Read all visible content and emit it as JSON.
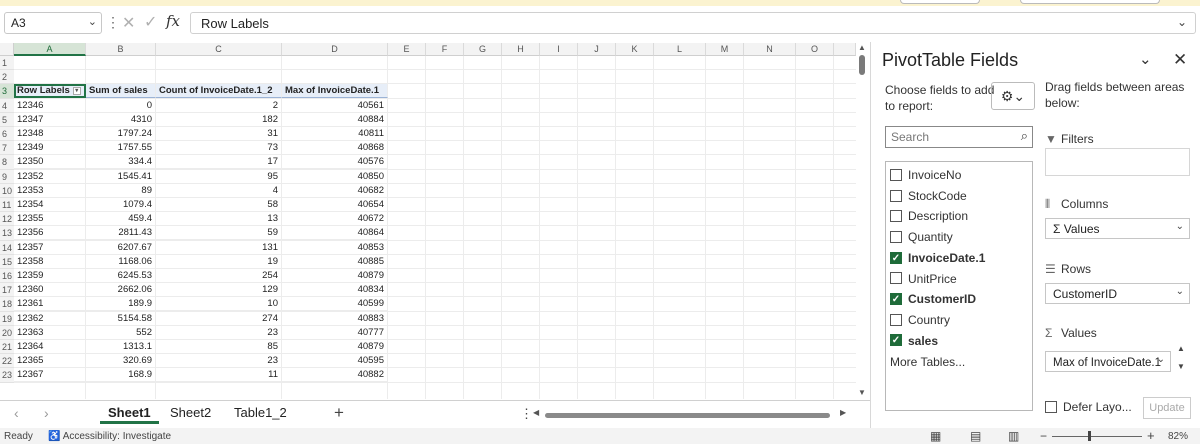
{
  "formula_bar": {
    "name_box": "A3",
    "formula": "Row Labels"
  },
  "columns": [
    "A",
    "B",
    "C",
    "D",
    "E",
    "F",
    "G",
    "H",
    "I",
    "J",
    "K",
    "L",
    "M",
    "N",
    "O"
  ],
  "pivot_table": {
    "headers": [
      "Row Labels",
      "Sum of sales",
      "Count of InvoiceDate.1_2",
      "Max of InvoiceDate.1"
    ],
    "rows": [
      [
        "12346",
        "0",
        "2",
        "40561"
      ],
      [
        "12347",
        "4310",
        "182",
        "40884"
      ],
      [
        "12348",
        "1797.24",
        "31",
        "40811"
      ],
      [
        "12349",
        "1757.55",
        "73",
        "40868"
      ],
      [
        "12350",
        "334.4",
        "17",
        "40576"
      ],
      [
        "12352",
        "1545.41",
        "95",
        "40850"
      ],
      [
        "12353",
        "89",
        "4",
        "40682"
      ],
      [
        "12354",
        "1079.4",
        "58",
        "40654"
      ],
      [
        "12355",
        "459.4",
        "13",
        "40672"
      ],
      [
        "12356",
        "2811.43",
        "59",
        "40864"
      ],
      [
        "12357",
        "6207.67",
        "131",
        "40853"
      ],
      [
        "12358",
        "1168.06",
        "19",
        "40885"
      ],
      [
        "12359",
        "6245.53",
        "254",
        "40879"
      ],
      [
        "12360",
        "2662.06",
        "129",
        "40834"
      ],
      [
        "12361",
        "189.9",
        "10",
        "40599"
      ],
      [
        "12362",
        "5154.58",
        "274",
        "40883"
      ],
      [
        "12363",
        "552",
        "23",
        "40777"
      ],
      [
        "12364",
        "1313.1",
        "85",
        "40879"
      ],
      [
        "12365",
        "320.69",
        "23",
        "40595"
      ],
      [
        "12367",
        "168.9",
        "11",
        "40882"
      ]
    ]
  },
  "row_numbers": [
    "1",
    "2",
    "3",
    "4",
    "5",
    "6",
    "7",
    "8",
    "9",
    "10",
    "11",
    "12",
    "13",
    "14",
    "15",
    "16",
    "17",
    "18",
    "19",
    "20",
    "21",
    "22",
    "23"
  ],
  "sheet_tabs": [
    "Sheet1",
    "Sheet2",
    "Table1_2"
  ],
  "active_sheet": "Sheet1",
  "status": {
    "ready": "Ready",
    "accessibility": "Accessibility: Investigate",
    "zoom": "82%"
  },
  "pivot_pane": {
    "title": "PivotTable Fields",
    "choose_label": "Choose fields to add to report:",
    "drag_label": "Drag fields between areas below:",
    "search_placeholder": "Search",
    "fields": [
      {
        "name": "InvoiceNo",
        "checked": false
      },
      {
        "name": "StockCode",
        "checked": false
      },
      {
        "name": "Description",
        "checked": false
      },
      {
        "name": "Quantity",
        "checked": false
      },
      {
        "name": "InvoiceDate.1",
        "checked": true
      },
      {
        "name": "UnitPrice",
        "checked": false
      },
      {
        "name": "CustomerID",
        "checked": true
      },
      {
        "name": "Country",
        "checked": false
      },
      {
        "name": "sales",
        "checked": true
      }
    ],
    "more_tables": "More Tables...",
    "areas": {
      "filters_label": "Filters",
      "columns_label": "Columns",
      "columns_item": "Σ Values",
      "rows_label": "Rows",
      "rows_item": "CustomerID",
      "values_label": "Values",
      "values_item": "Max of InvoiceDate.1"
    },
    "defer_label": "Defer Layo...",
    "update_label": "Update"
  },
  "colors": {
    "excel_green": "#217346",
    "header_highlight": "#e7eef8"
  }
}
